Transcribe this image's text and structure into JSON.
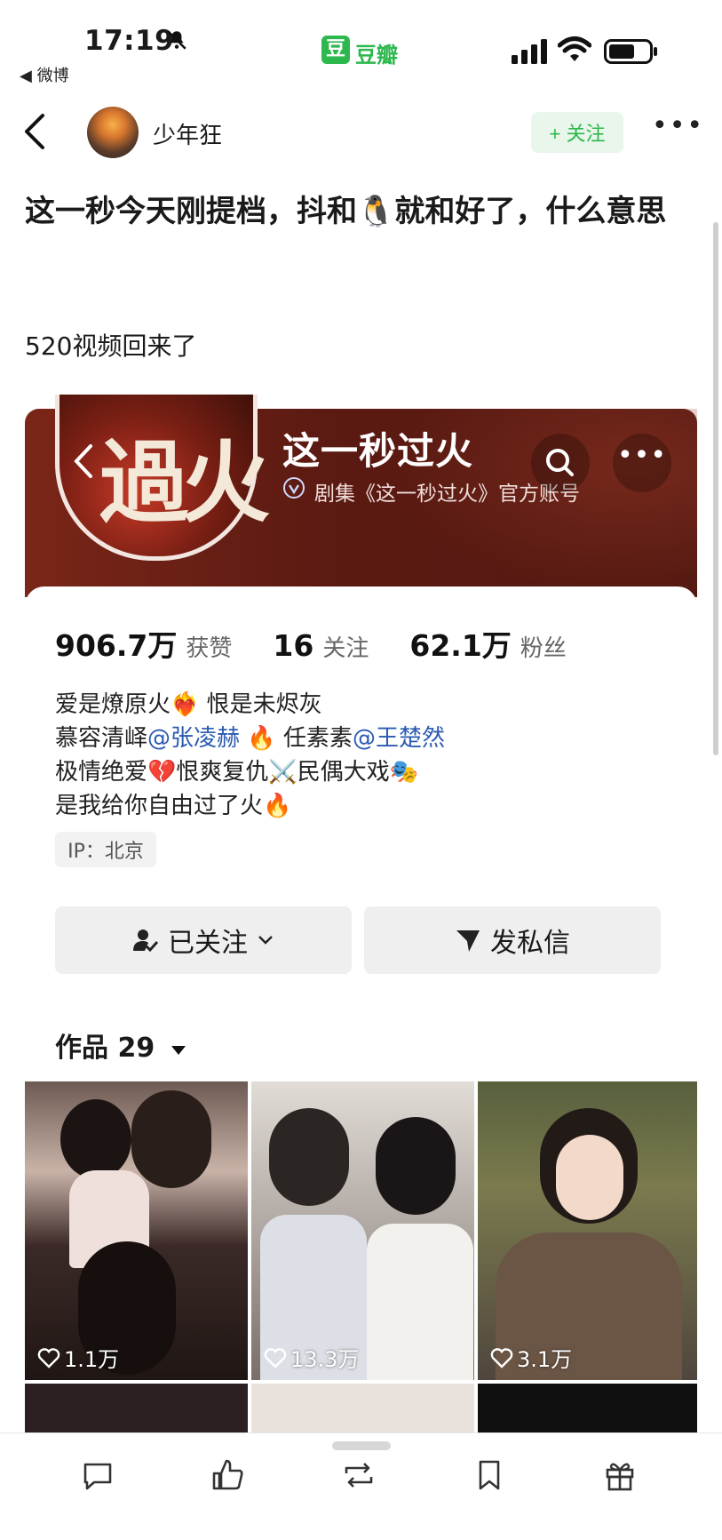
{
  "status_bar": {
    "time": "17:19",
    "back_app": "◀ 微博",
    "app_name": "豆瓣"
  },
  "header": {
    "username": "少年狂",
    "follow_label": "+ 关注"
  },
  "post": {
    "title": "这一秒今天刚提档，抖和🐧就和好了，什么意思",
    "body": "520视频回来了"
  },
  "profile": {
    "poster_text": "過火",
    "account_name": "这一秒过火",
    "verified_text": "剧集《这一秒过火》官方账号",
    "stats": [
      {
        "value": "906.7万",
        "label": "获赞"
      },
      {
        "value": "16",
        "label": "关注"
      },
      {
        "value": "62.1万",
        "label": "粉丝"
      }
    ],
    "bio": {
      "line1": "爱是燎原火❤️‍🔥 恨是未烬灰",
      "line2_a": "慕容清峄",
      "line2_mention1": "@张凌赫",
      "line2_b": " 🔥 任素素",
      "line2_mention2": "@王楚然",
      "line3": "极情绝爱💔恨爽复仇⚔️民偶大戏🎭",
      "line4": "是我给你自由过了火🔥"
    },
    "ip": "IP：北京",
    "followed_label": "已关注",
    "message_label": "发私信",
    "works_label": "作品 29",
    "works": [
      {
        "likes": "1.1万"
      },
      {
        "likes": "13.3万"
      },
      {
        "likes": "3.1万"
      }
    ]
  },
  "bottom_bar": {
    "icons": [
      "comment-icon",
      "like-icon",
      "repost-icon",
      "bookmark-icon",
      "gift-icon"
    ]
  }
}
